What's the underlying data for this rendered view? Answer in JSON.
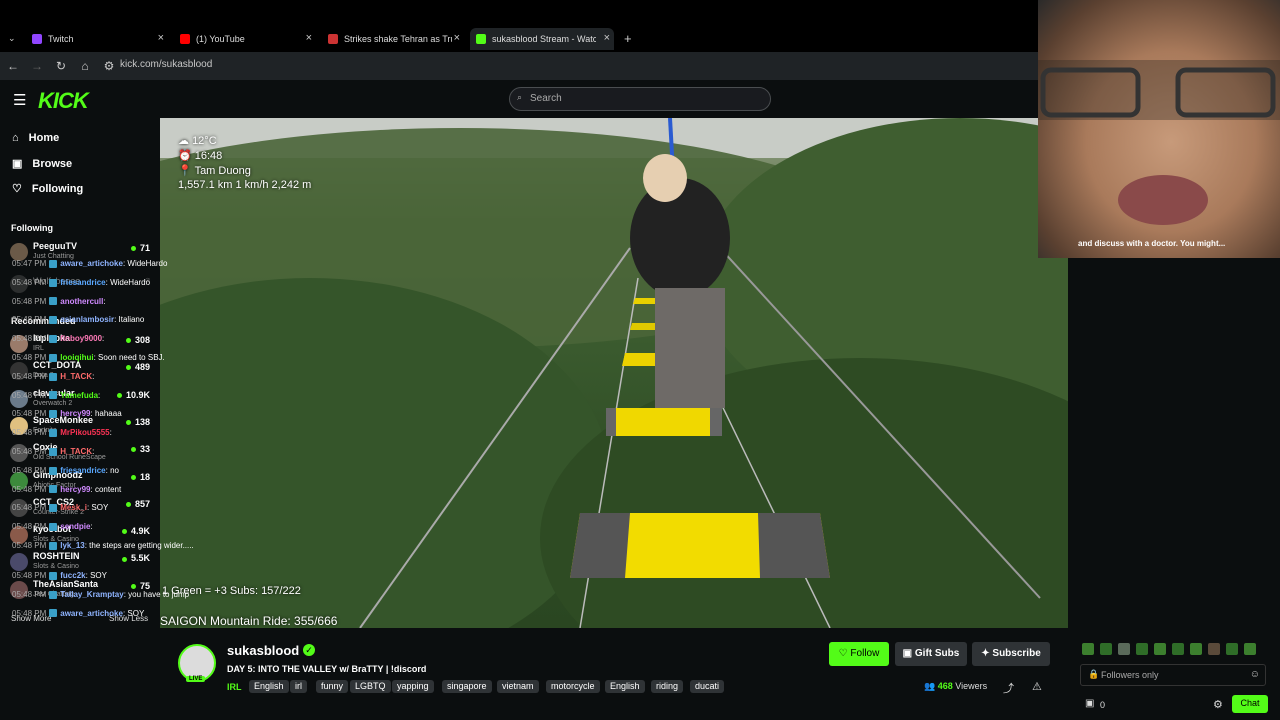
{
  "browser": {
    "tabs": [
      {
        "title": "Twitch",
        "color": "#9146ff"
      },
      {
        "title": "(1) YouTube",
        "color": "#ff0000"
      },
      {
        "title": "Strikes shake Tehran as Trump p",
        "color": "#cc3333"
      },
      {
        "title": "sukasblood Stream - Watch Live",
        "color": "#53fc18"
      }
    ],
    "url": "kick.com/sukasblood"
  },
  "header": {
    "logo": "KICK",
    "search_placeholder": "Search"
  },
  "sidebar": {
    "nav": [
      {
        "label": "Home",
        "icon": "home-icon"
      },
      {
        "label": "Browse",
        "icon": "browse-icon"
      },
      {
        "label": "Following",
        "icon": "heart-icon"
      }
    ],
    "following_title": "Following",
    "following": [
      {
        "name": "PeeguuTV",
        "game": "Just Chatting",
        "viewers": "71"
      },
      {
        "name": "Wolfsbanee",
        "game": "",
        "viewers": ""
      }
    ],
    "recommended_title": "Recommended",
    "recommended": [
      {
        "name": "luplupka",
        "game": "IRL",
        "viewers": "308"
      },
      {
        "name": "CCT_DOTA",
        "game": "Dota 2",
        "viewers": "489"
      },
      {
        "name": "clavicular",
        "game": "Overwatch 2",
        "viewers": "10.9K"
      },
      {
        "name": "SpaceMonkee",
        "game": "Fortnite",
        "viewers": "138"
      },
      {
        "name": "Coxie",
        "game": "Old School RuneScape",
        "viewers": "33"
      },
      {
        "name": "Gimpnoodz",
        "game": "Abiotic Factor",
        "viewers": "18"
      },
      {
        "name": "CCT_CS2",
        "game": "Counter-Strike 2",
        "viewers": "857"
      },
      {
        "name": "kyootbot",
        "game": "Slots & Casino",
        "viewers": "4.9K"
      },
      {
        "name": "ROSHTEIN",
        "game": "Slots & Casino",
        "viewers": "5.5K"
      },
      {
        "name": "TheAsianSanta",
        "game": "Just Chatting",
        "viewers": "75"
      }
    ],
    "show_more": "Show More",
    "show_less": "Show Less"
  },
  "video": {
    "temp": "12°C",
    "time": "16:48",
    "location": "Tam Duong",
    "stats": "1,557.1 km  1 km/h  2,242 m",
    "goal1": "1 Green = +3 Subs: 157/222",
    "goal2": "SAIGON Mountain Ride: 355/666"
  },
  "stream": {
    "channel": "sukasblood",
    "live_label": "LIVE",
    "title": "DAY 5: INTO THE VALLEY w/ BraTTY | !discord",
    "category": "IRL",
    "tags": [
      "English",
      "irl",
      "funny",
      "LGBTQ",
      "yapping",
      "singapore",
      "vietnam",
      "motorcycle",
      "English",
      "riding",
      "ducati"
    ],
    "follow_label": "Follow",
    "gift_label": "Gift Subs",
    "subscribe_label": "Subscribe",
    "viewers": "468",
    "viewers_label": "Viewers"
  },
  "chat": {
    "pinned": "and discuss with a doctor. You might...",
    "messages": [
      {
        "time": "05:47 PM",
        "user": "aware_artichoke",
        "color": "#8fb4ff",
        "text": "WideHardo"
      },
      {
        "time": "05:48 PM",
        "user": "friesandrice",
        "color": "#5aa8ff",
        "text": "WideHardo"
      },
      {
        "time": "05:48 PM",
        "user": "anothercull",
        "color": "#d08aff",
        "text": ""
      },
      {
        "time": "05:48 PM",
        "user": "asianlambosir",
        "color": "#8fb4ff",
        "text": "Italiano"
      },
      {
        "time": "05:48 PM",
        "user": "finboy9000",
        "color": "#ff7ab8",
        "text": ""
      },
      {
        "time": "05:48 PM",
        "user": "looiqihui",
        "color": "#53fc18",
        "text": "Soon need to SBJ."
      },
      {
        "time": "05:48 PM",
        "user": "H_TACK",
        "color": "#ff6b6b",
        "text": ""
      },
      {
        "time": "05:48 PM",
        "user": "Yamefuda",
        "color": "#53fc18",
        "text": ""
      },
      {
        "time": "05:48 PM",
        "user": "hercy99",
        "color": "#d08aff",
        "text": "hahaaa"
      },
      {
        "time": "05:48 PM",
        "user": "MrPikou5555",
        "color": "#ff3355",
        "text": ""
      },
      {
        "time": "05:48 PM",
        "user": "H_TACK",
        "color": "#ff6b6b",
        "text": ""
      },
      {
        "time": "05:48 PM",
        "user": "friesandrice",
        "color": "#5aa8ff",
        "text": "no"
      },
      {
        "time": "05:48 PM",
        "user": "hercy99",
        "color": "#d08aff",
        "text": "content"
      },
      {
        "time": "05:48 PM",
        "user": "Mesk_i",
        "color": "#ff6b6b",
        "text": "SOY"
      },
      {
        "time": "05:48 PM",
        "user": "sendpie",
        "color": "#d08aff",
        "text": ""
      },
      {
        "time": "05:48 PM",
        "user": "lyk_13",
        "color": "#8fb4ff",
        "text": "the steps are getting wider....."
      },
      {
        "time": "05:48 PM",
        "user": "fucc2k",
        "color": "#8fb4ff",
        "text": "SOY"
      },
      {
        "time": "05:48 PM",
        "user": "Tallay_Kramptay",
        "color": "#8fb4ff",
        "text": "you have to jump"
      },
      {
        "time": "05:48 PM",
        "user": "aware_artichoke",
        "color": "#8fb4ff",
        "text": "SOY"
      }
    ],
    "input_placeholder": "Followers only",
    "count": "0",
    "chat_button": "Chat"
  }
}
